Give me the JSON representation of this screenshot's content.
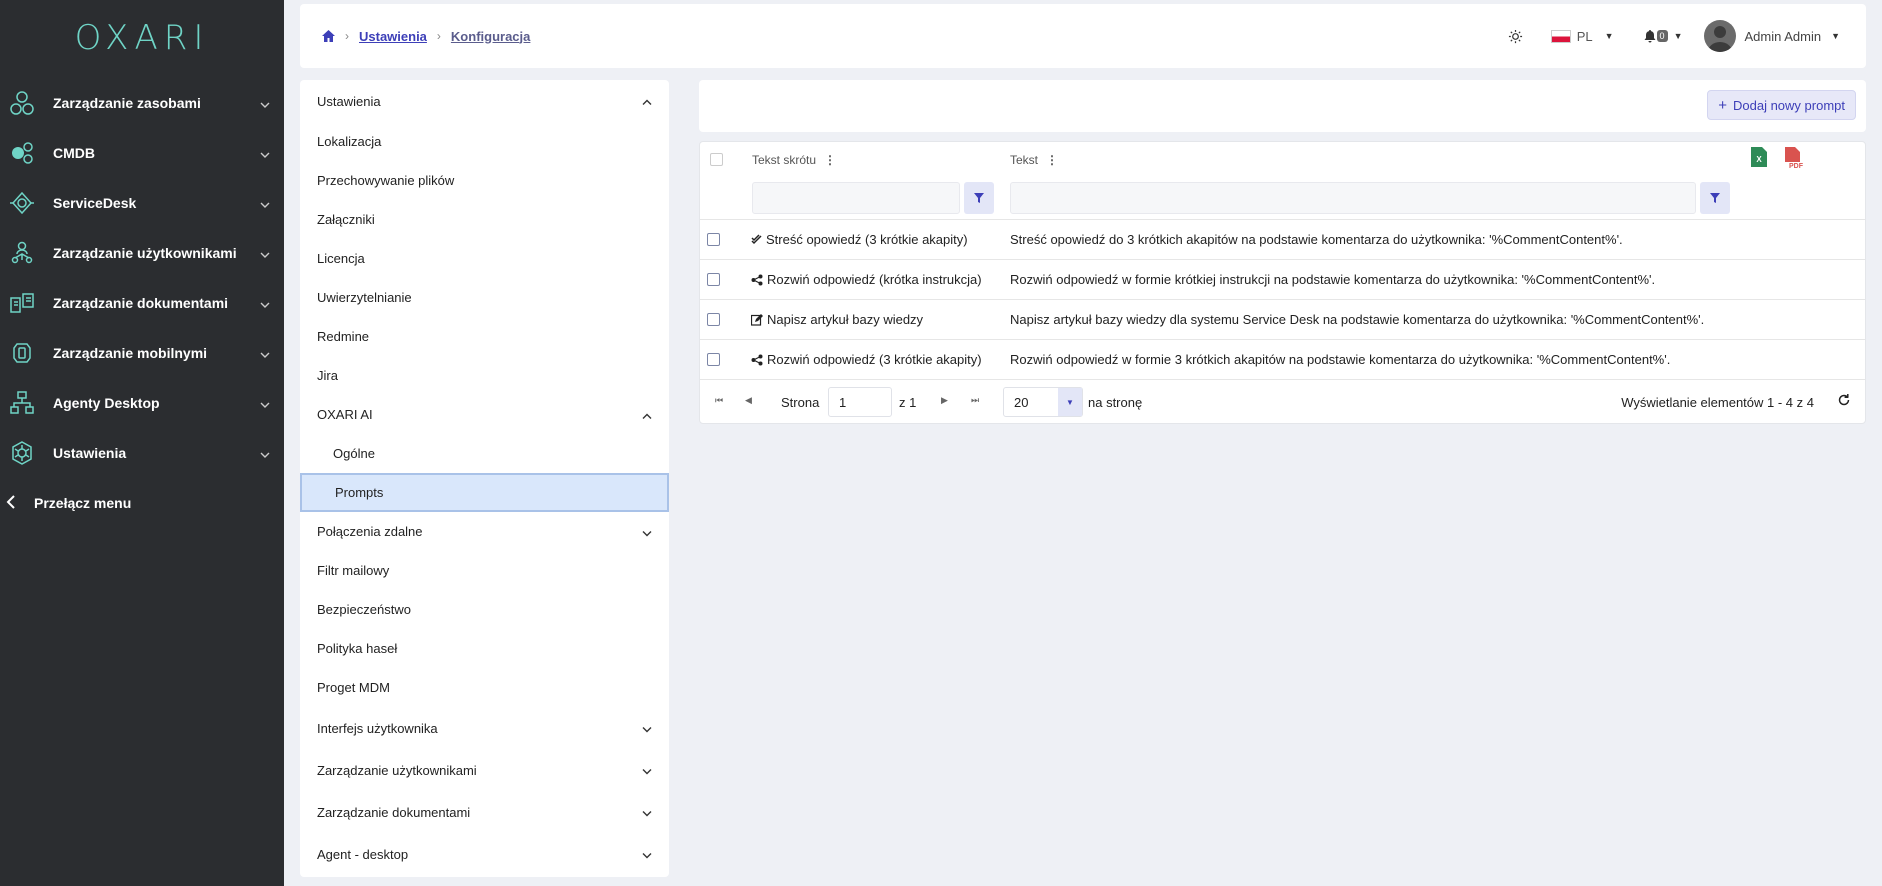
{
  "app": {
    "logo": "OXARI"
  },
  "sidebar": {
    "items": [
      {
        "label": "Zarządzanie zasobami",
        "icon": "assets-icon"
      },
      {
        "label": "CMDB",
        "icon": "cmdb-icon"
      },
      {
        "label": "ServiceDesk",
        "icon": "servicedesk-icon"
      },
      {
        "label": "Zarządzanie użytkownikami",
        "icon": "users-icon"
      },
      {
        "label": "Zarządzanie dokumentami",
        "icon": "documents-icon"
      },
      {
        "label": "Zarządzanie mobilnymi",
        "icon": "mobile-icon"
      },
      {
        "label": "Agenty Desktop",
        "icon": "desktop-agents-icon"
      },
      {
        "label": "Ustawienia",
        "icon": "settings-icon"
      }
    ],
    "toggle_label": "Przełącz menu"
  },
  "header": {
    "breadcrumb": [
      "Ustawienia",
      "Konfiguracja"
    ],
    "language": "PL",
    "notifications_count": "0",
    "user_name": "Admin Admin"
  },
  "settings_nav": {
    "items": [
      {
        "label": "Ustawienia"
      },
      {
        "label": "Lokalizacja"
      },
      {
        "label": "Przechowywanie plików"
      },
      {
        "label": "Załączniki"
      },
      {
        "label": "Licencja"
      },
      {
        "label": "Uwierzytelnianie"
      },
      {
        "label": "Redmine"
      },
      {
        "label": "Jira"
      },
      {
        "label": "OXARI AI"
      },
      {
        "label": "Ogólne"
      },
      {
        "label": "Prompts"
      },
      {
        "label": "Połączenia zdalne"
      },
      {
        "label": "Filtr mailowy"
      },
      {
        "label": "Bezpieczeństwo"
      },
      {
        "label": "Polityka haseł"
      },
      {
        "label": "Proget MDM"
      },
      {
        "label": "Interfejs użytkownika"
      },
      {
        "label": "Zarządzanie użytkownikami"
      },
      {
        "label": "Zarządzanie dokumentami"
      },
      {
        "label": "Agent - desktop"
      }
    ]
  },
  "toolbar": {
    "add_label": "Dodaj nowy prompt"
  },
  "table": {
    "columns": [
      "Tekst skrótu",
      "Tekst"
    ],
    "rows": [
      {
        "icon": "check-double-icon",
        "shortcut": "Streść opowiedź (3 krótkie akapity)",
        "text": "Streść opowiedź do 3 krótkich akapitów na podstawie komentarza do użytkownika: '%CommentContent%'."
      },
      {
        "icon": "share-nodes-icon",
        "shortcut": "Rozwiń odpowiedź (krótka instrukcja)",
        "text": "Rozwiń odpowiedź w formie krótkiej instrukcji na podstawie komentarza do użytkownika: '%CommentContent%'."
      },
      {
        "icon": "edit-icon",
        "shortcut": "Napisz artykuł bazy wiedzy",
        "text": "Napisz artykuł bazy wiedzy dla systemu Service Desk na podstawie komentarza do użytkownika: '%CommentContent%'."
      },
      {
        "icon": "share-nodes-icon",
        "shortcut": "Rozwiń odpowiedź (3 krótkie akapity)",
        "text": "Rozwiń odpowiedź w formie 3 krótkich akapitów na podstawie komentarza do użytkownika: '%CommentContent%'."
      }
    ]
  },
  "pagination": {
    "page_label": "Strona",
    "page_value": "1",
    "of_label": "z 1",
    "page_size": "20",
    "per_page_label": "na stronę",
    "info": "Wyświetlanie elementów 1 - 4 z 4"
  },
  "colors": {
    "sidebar_bg": "#2b2d30",
    "accent": "#3d3fb8",
    "logo": "#6fd4c6",
    "selected_bg": "#d9e7fb"
  }
}
